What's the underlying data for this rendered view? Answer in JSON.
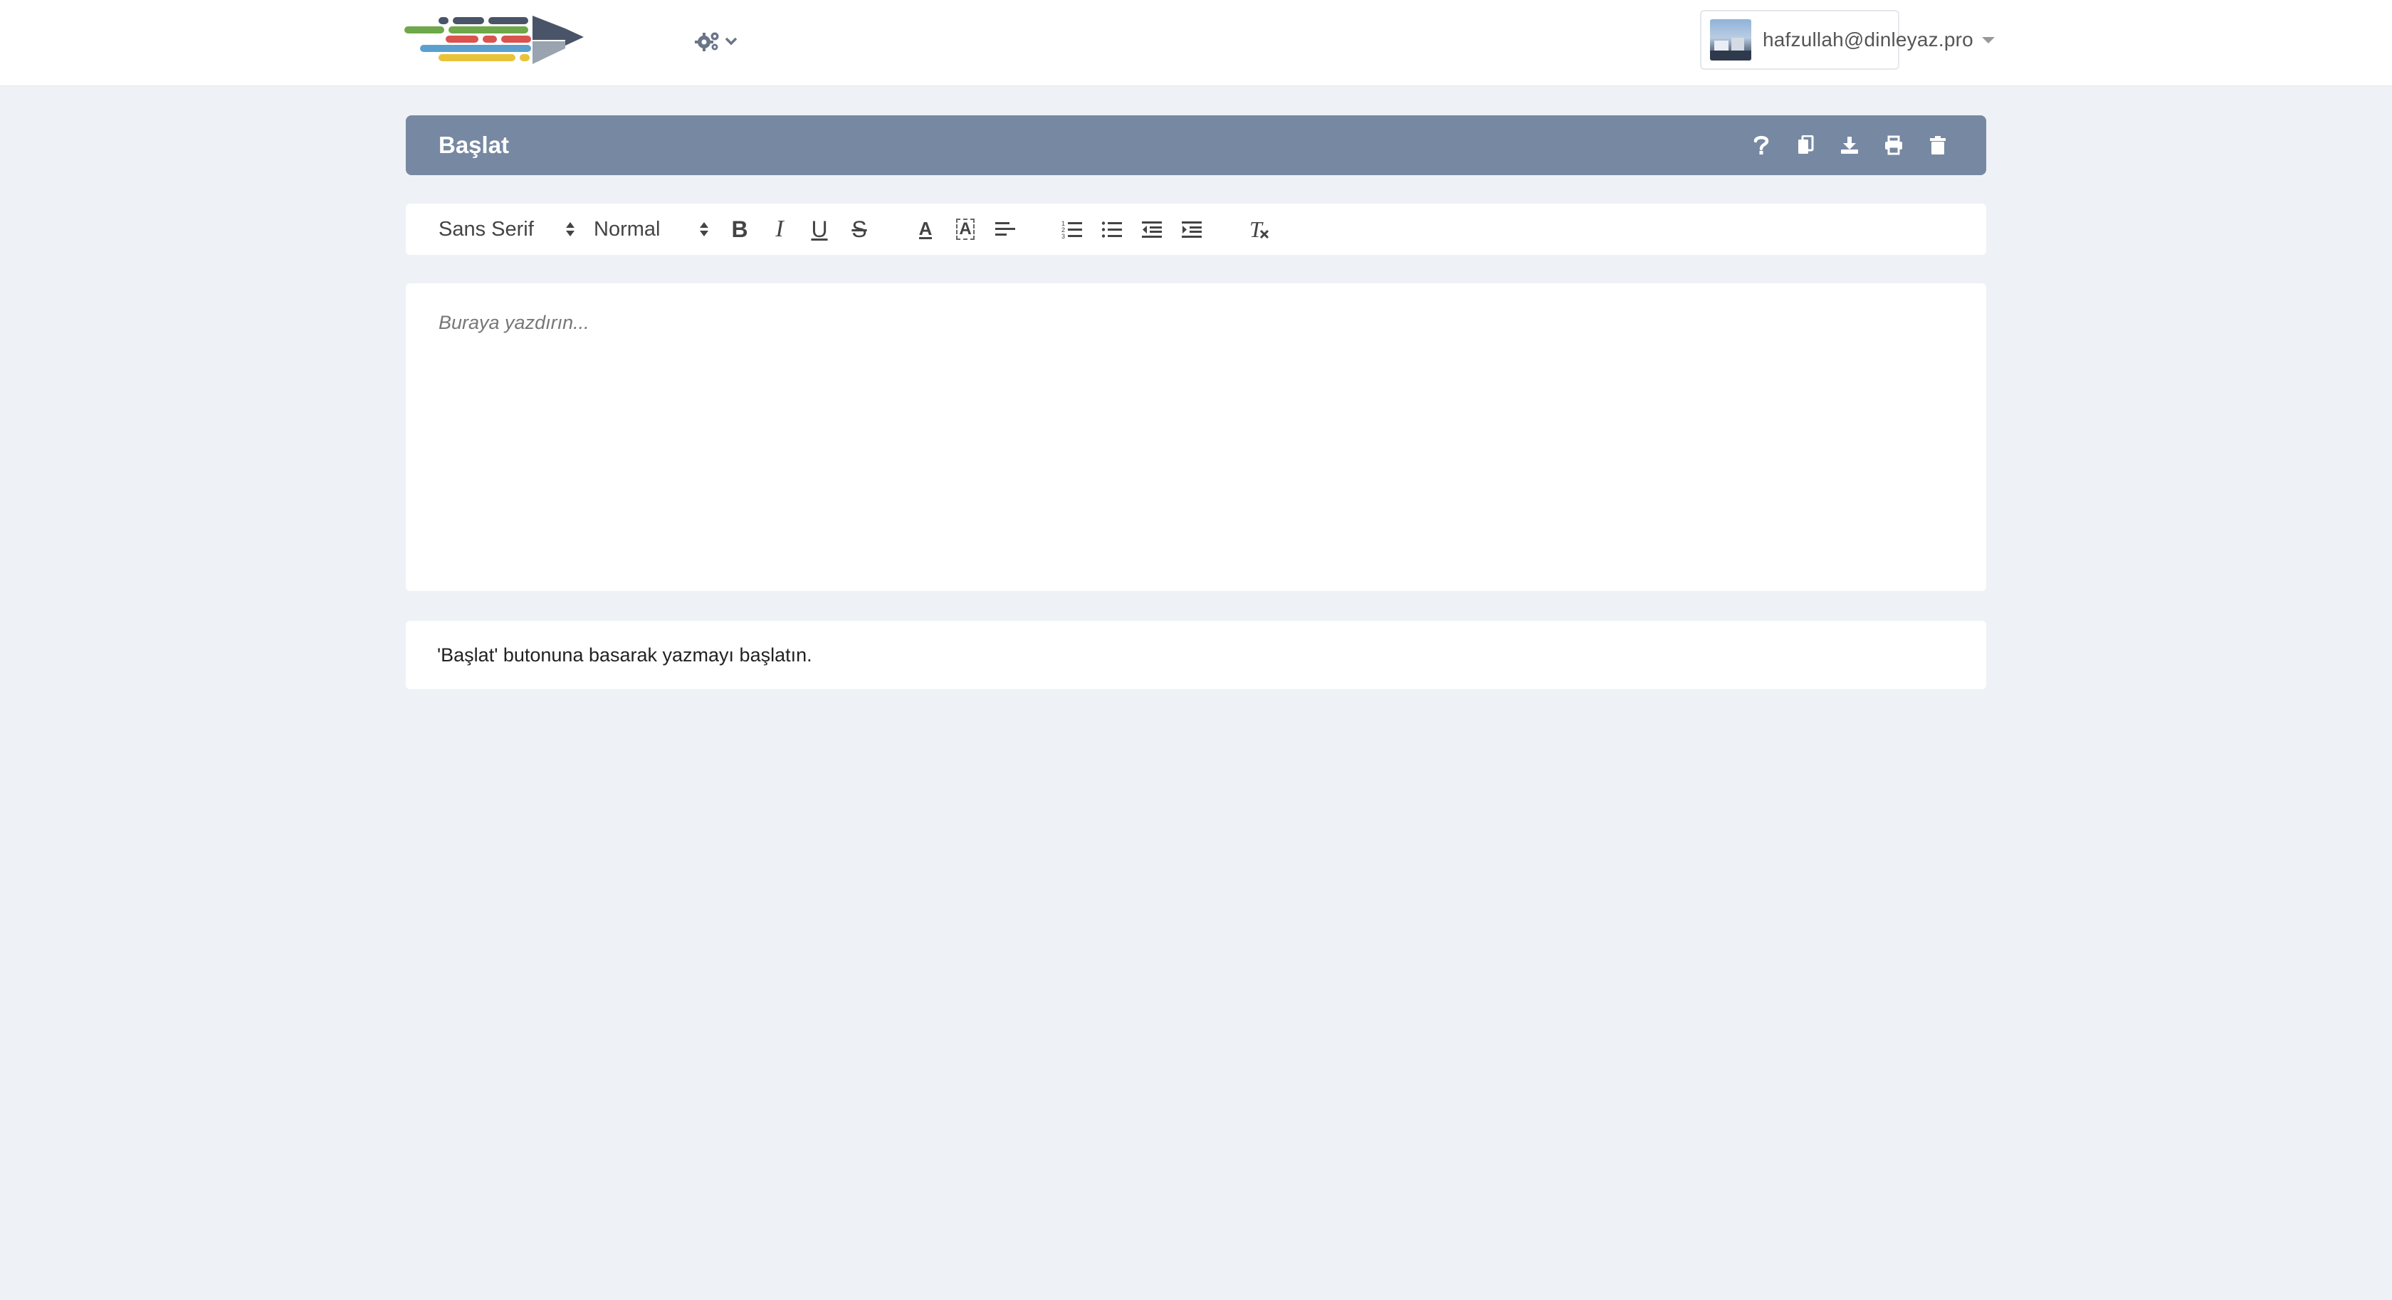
{
  "navbar": {
    "logo_name": "app-logo",
    "settings_icon": "gears-icon",
    "user": {
      "email": "hafzullah@dinleyaz.pro",
      "avatar_icon": "avatar"
    }
  },
  "title_bar": {
    "title": "Başlat",
    "actions": [
      {
        "name": "help-icon",
        "label": "?"
      },
      {
        "name": "copy-icon"
      },
      {
        "name": "download-icon"
      },
      {
        "name": "print-icon"
      },
      {
        "name": "trash-icon"
      }
    ]
  },
  "toolbar": {
    "font_family": "Sans Serif",
    "font_size": "Normal",
    "buttons": [
      "bold-icon",
      "italic-icon",
      "underline-icon",
      "strikethrough-icon",
      "text-color-icon",
      "background-color-icon",
      "align-left-icon",
      "ordered-list-icon",
      "bullet-list-icon",
      "outdent-icon",
      "indent-icon",
      "clear-format-icon"
    ],
    "bold_glyph": "B",
    "italic_glyph": "I",
    "underline_glyph": "U",
    "strike_glyph": "S",
    "color_glyph": "A",
    "bg_glyph": "A",
    "clear_glyph": "T"
  },
  "editor": {
    "placeholder": "Buraya yazdırın..."
  },
  "status": {
    "message": "'Başlat' butonuna basarak yazmayı başlatın."
  },
  "colors": {
    "title_bar": "#7788a2",
    "page_bg": "#eef1f6",
    "logo_green": "#6ea84a",
    "logo_red": "#d9534f",
    "logo_blue": "#5aa0cf",
    "logo_yellow": "#e8c33a",
    "logo_dark": "#4a5468"
  }
}
